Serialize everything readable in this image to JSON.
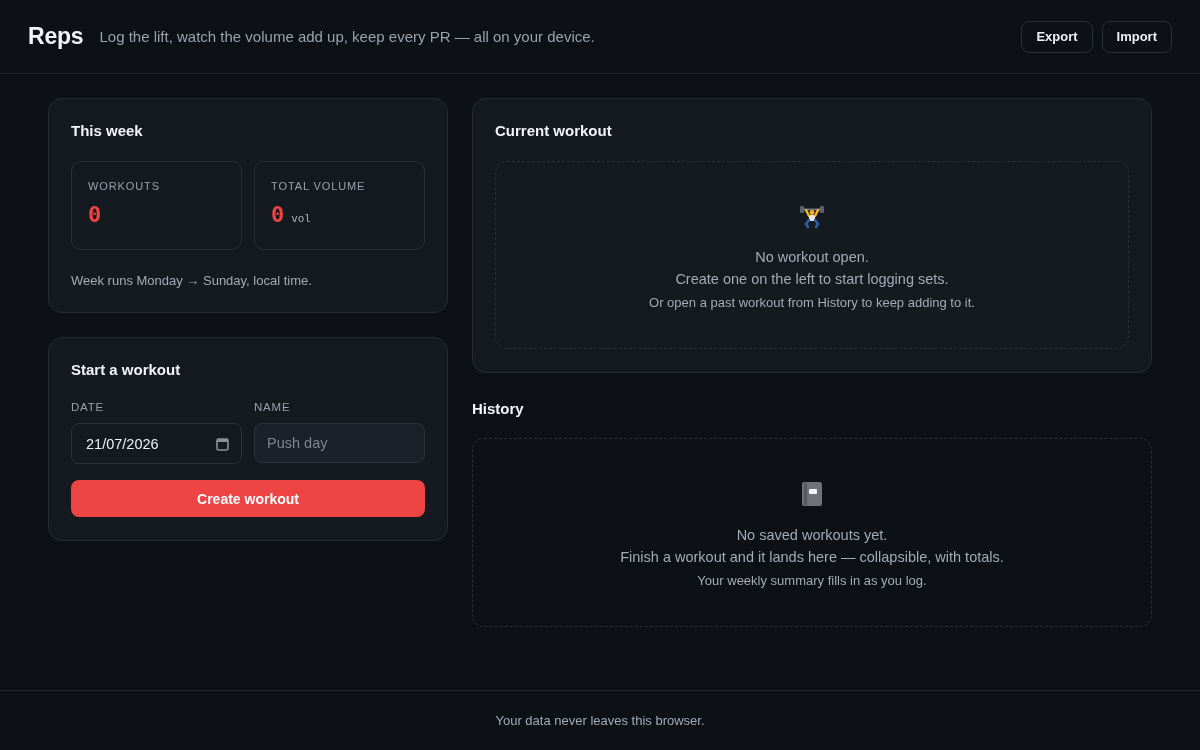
{
  "header": {
    "logo": "Reps",
    "tagline": "Log the lift, watch the volume add up, keep every PR — all on your device.",
    "buttons": [
      "Export",
      "Import"
    ]
  },
  "this_week": {
    "title": "This week",
    "stats": [
      {
        "label": "WORKOUTS",
        "value": "0"
      },
      {
        "label": "TOTAL VOLUME",
        "value": "0",
        "unit": "vol"
      }
    ],
    "note": "Week runs Monday → Sunday, local time."
  },
  "start_workout": {
    "title": "Start a workout",
    "fields": [
      {
        "kind": "date",
        "label": "DATE",
        "value": "21/07/2026"
      },
      {
        "kind": "text",
        "label": "NAME",
        "placeholder": "Push day"
      }
    ],
    "button": "Create workout"
  },
  "current_workout": {
    "title": "Current workout",
    "empty": {
      "lines": [
        "No workout open.",
        "Create one on the left to start logging sets."
      ],
      "hint": "Or open a past workout from History to keep adding to it."
    }
  },
  "history": {
    "title": "History",
    "empty": {
      "lines": [
        "No saved workouts yet.",
        "Finish a workout and it lands here — collapsible, with totals."
      ],
      "hint": "Your weekly summary fills in as you log."
    }
  },
  "footer": {
    "text": "Your data never leaves this browser."
  }
}
